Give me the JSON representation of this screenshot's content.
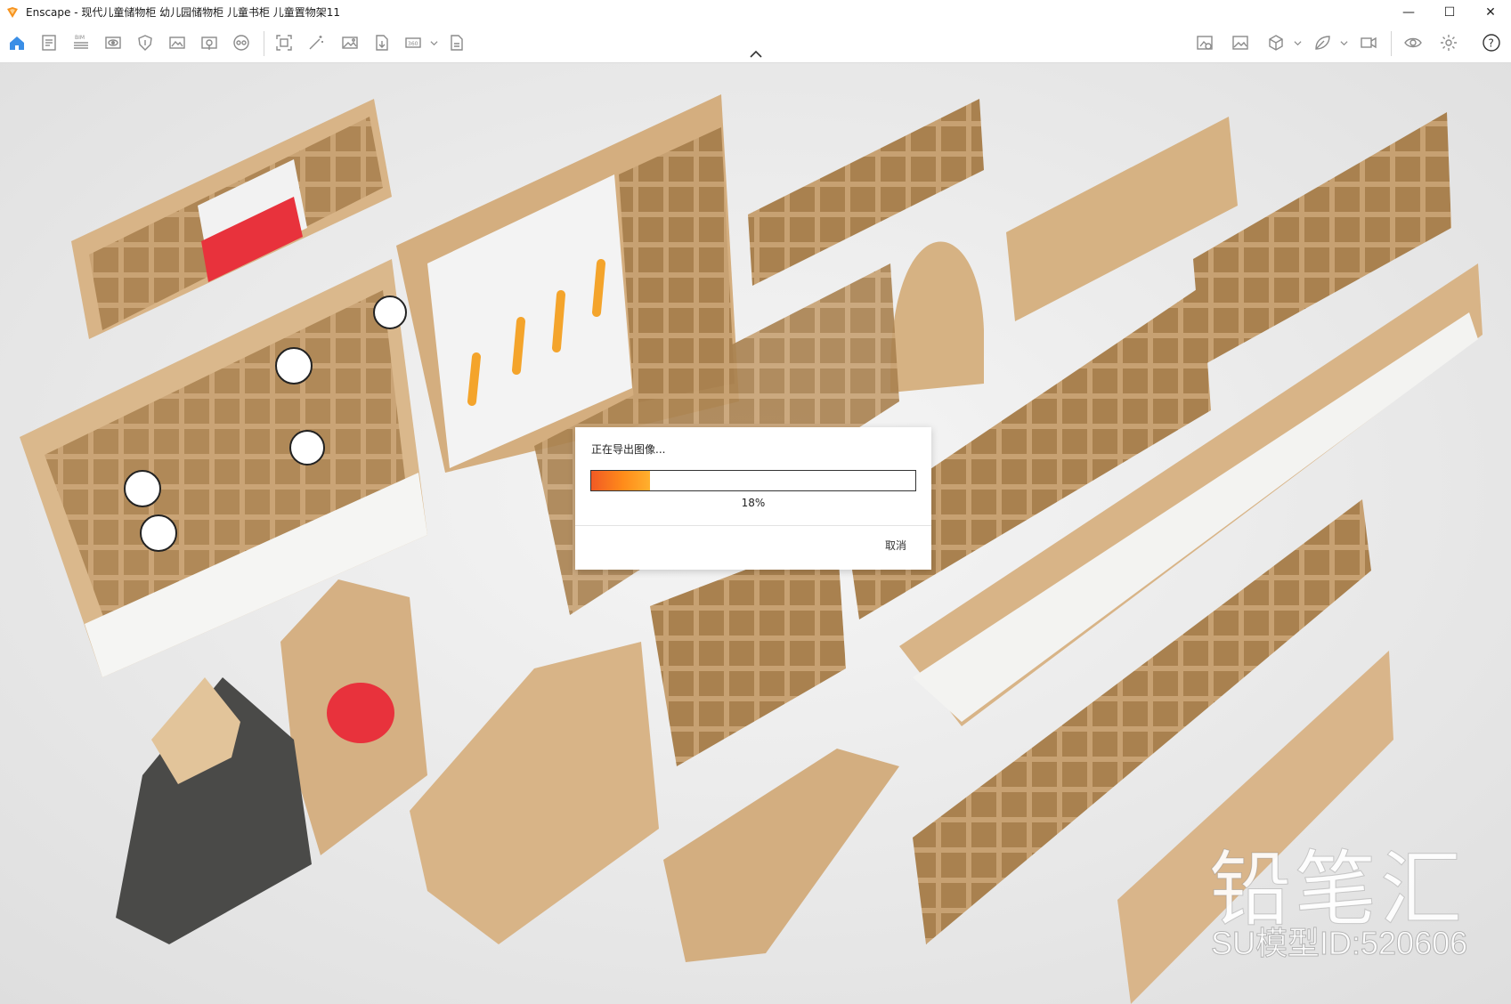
{
  "window": {
    "title": "Enscape - 现代儿童储物柜 幼儿园储物柜 儿童书柜 儿童置物架11",
    "controls": {
      "minimize": "—",
      "maximize": "☐",
      "close": "✕"
    }
  },
  "toolbar": {
    "left_icons": [
      "home-icon",
      "document-icon",
      "bim-icon",
      "view-icon",
      "shield-icon",
      "panorama-icon",
      "video-icon",
      "vr-icon",
      "capture-icon",
      "magic-icon",
      "image-icon",
      "export-icon",
      "screenshot-360-icon",
      "batch-render-icon"
    ],
    "right_icons": [
      "asset-icon",
      "material-icon",
      "cube-icon",
      "leaf-icon",
      "sync-icon",
      "eye-icon",
      "settings-icon",
      "help-icon"
    ],
    "bim_label": "BIM",
    "vr_label": "360",
    "help_label": "?"
  },
  "export_dialog": {
    "message": "正在导出图像...",
    "progress_fraction": 0.18,
    "progress_text": "18%",
    "cancel_label": "取消"
  },
  "watermark": {
    "brand": "铅笔汇",
    "model_id": "SU模型ID:520606"
  },
  "colors": {
    "accent": "#f7931e",
    "wood": "#d9b58a",
    "wood_dark": "#b08b60",
    "cabinet_white": "#f4f4f2",
    "highlight_red": "#e8323c"
  }
}
